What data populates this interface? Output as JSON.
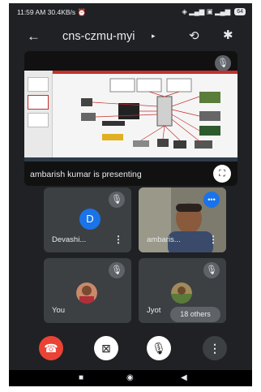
{
  "status": {
    "time": "11:59 AM",
    "speed": "30.4KB/s",
    "alarm_icon": "alarm-icon",
    "battery": "64"
  },
  "header": {
    "meeting_code": "cns-czmu-myi",
    "caret": "▸",
    "back_icon": "back-arrow-icon",
    "switch_camera_icon": "switch-camera-icon",
    "bluetooth_icon": "bluetooth-icon"
  },
  "presentation": {
    "label": "ambarish kumar is presenting"
  },
  "tiles": [
    {
      "initial": "D",
      "name": "Devashi...",
      "muted": true
    },
    {
      "name": "ambaris...",
      "speaking": true
    },
    {
      "name": "You",
      "muted": true
    },
    {
      "name": "Jyot",
      "muted": true
    }
  ],
  "others_badge": "18 others",
  "colors": {
    "background": "#202124",
    "tile": "#3c4043",
    "end_call": "#ea4335",
    "avatar": "#1a73e8"
  }
}
